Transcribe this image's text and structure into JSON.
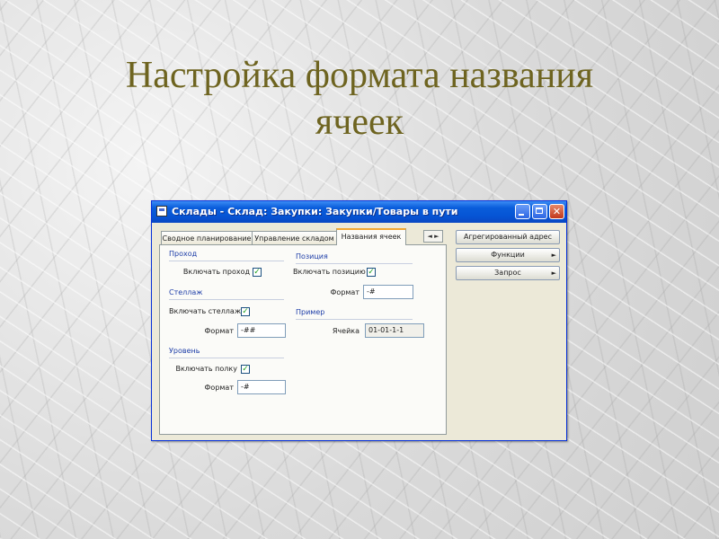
{
  "slide": {
    "title_line1": "Настройка формата названия",
    "title_line2": "ячеек"
  },
  "window": {
    "title": "Склады - Склад: Закупки: Закупки/Товары в пути",
    "minimize_glyph": "",
    "maximize_glyph": "",
    "close_glyph": "✕"
  },
  "tabs": [
    {
      "label": "Сводное планирование",
      "active": false
    },
    {
      "label": "Управление складом",
      "active": false
    },
    {
      "label": "Названия ячеек",
      "active": true
    }
  ],
  "tab_nav": {
    "prev": "◄",
    "next": "►"
  },
  "groups": {
    "row": {
      "title": "Проход",
      "include_label": "Включать проход",
      "include_checked": true
    },
    "rack": {
      "title": "Стеллаж",
      "include_label": "Включать стеллаж",
      "include_checked": true,
      "format_label": "Формат",
      "format_value": "-##"
    },
    "level": {
      "title": "Уровень",
      "include_label": "Включать полку",
      "include_checked": true,
      "format_label": "Формат",
      "format_value": "-#"
    },
    "position": {
      "title": "Позиция",
      "include_label": "Включать позицию",
      "include_checked": true,
      "format_label": "Формат",
      "format_value": "-#"
    },
    "example": {
      "title": "Пример",
      "cell_label": "Ячейка",
      "cell_value": "01-01-1-1"
    }
  },
  "side_buttons": [
    {
      "label": "Агрегированный адрес",
      "has_arrow": false
    },
    {
      "label": "Функции",
      "has_arrow": true
    },
    {
      "label": "Запрос",
      "has_arrow": true
    }
  ],
  "arrow_glyph": "►",
  "check_glyph": "✓"
}
